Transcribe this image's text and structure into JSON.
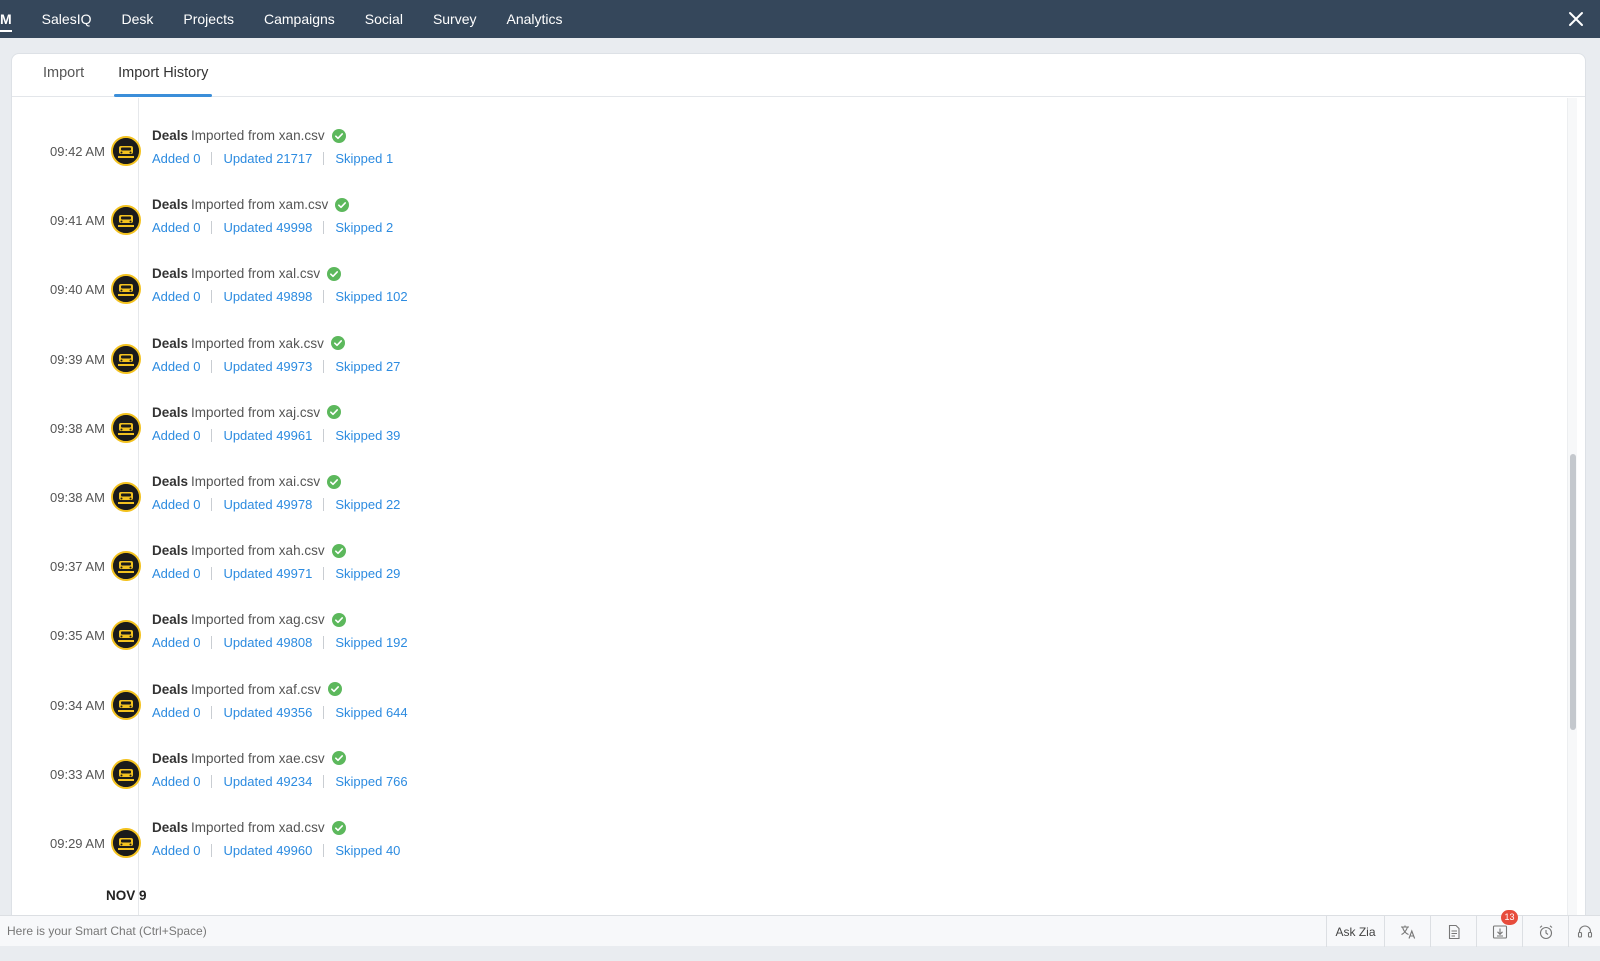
{
  "topnav": {
    "items": [
      "M",
      "SalesIQ",
      "Desk",
      "Projects",
      "Campaigns",
      "Social",
      "Survey",
      "Analytics"
    ]
  },
  "tabs": [
    "Import",
    "Import History"
  ],
  "entries": [
    {
      "time": "09:42 AM",
      "module": "Deals",
      "text": "Imported from xan.csv",
      "added": "Added 0",
      "updated": "Updated 21717",
      "skipped": "Skipped 1"
    },
    {
      "time": "09:41 AM",
      "module": "Deals",
      "text": "Imported from xam.csv",
      "added": "Added 0",
      "updated": "Updated 49998",
      "skipped": "Skipped 2"
    },
    {
      "time": "09:40 AM",
      "module": "Deals",
      "text": "Imported from xal.csv",
      "added": "Added 0",
      "updated": "Updated 49898",
      "skipped": "Skipped 102"
    },
    {
      "time": "09:39 AM",
      "module": "Deals",
      "text": "Imported from xak.csv",
      "added": "Added 0",
      "updated": "Updated 49973",
      "skipped": "Skipped 27"
    },
    {
      "time": "09:38 AM",
      "module": "Deals",
      "text": "Imported from xaj.csv",
      "added": "Added 0",
      "updated": "Updated 49961",
      "skipped": "Skipped 39"
    },
    {
      "time": "09:38 AM",
      "module": "Deals",
      "text": "Imported from xai.csv",
      "added": "Added 0",
      "updated": "Updated 49978",
      "skipped": "Skipped 22"
    },
    {
      "time": "09:37 AM",
      "module": "Deals",
      "text": "Imported from xah.csv",
      "added": "Added 0",
      "updated": "Updated 49971",
      "skipped": "Skipped 29"
    },
    {
      "time": "09:35 AM",
      "module": "Deals",
      "text": "Imported from xag.csv",
      "added": "Added 0",
      "updated": "Updated 49808",
      "skipped": "Skipped 192"
    },
    {
      "time": "09:34 AM",
      "module": "Deals",
      "text": "Imported from xaf.csv",
      "added": "Added 0",
      "updated": "Updated 49356",
      "skipped": "Skipped 644"
    },
    {
      "time": "09:33 AM",
      "module": "Deals",
      "text": "Imported from xae.csv",
      "added": "Added 0",
      "updated": "Updated 49234",
      "skipped": "Skipped 766"
    },
    {
      "time": "09:29 AM",
      "module": "Deals",
      "text": "Imported from xad.csv",
      "added": "Added 0",
      "updated": "Updated 49960",
      "skipped": "Skipped 40"
    }
  ],
  "date_heading": "NOV 9",
  "bottombar": {
    "smartchat_placeholder": "Here is your Smart Chat (Ctrl+Space)",
    "ask_zia": "Ask Zia",
    "notification_count": "13",
    "icons": [
      "translate-icon",
      "notes-icon",
      "download-icon",
      "alarm-clock-icon",
      "support-icon"
    ]
  },
  "colors": {
    "topnav_bg": "#35475b",
    "link_blue": "#2c8be0",
    "success_green": "#5cb85c",
    "tab_underline": "#3b8ed9",
    "badge_red": "#e74c3c"
  }
}
